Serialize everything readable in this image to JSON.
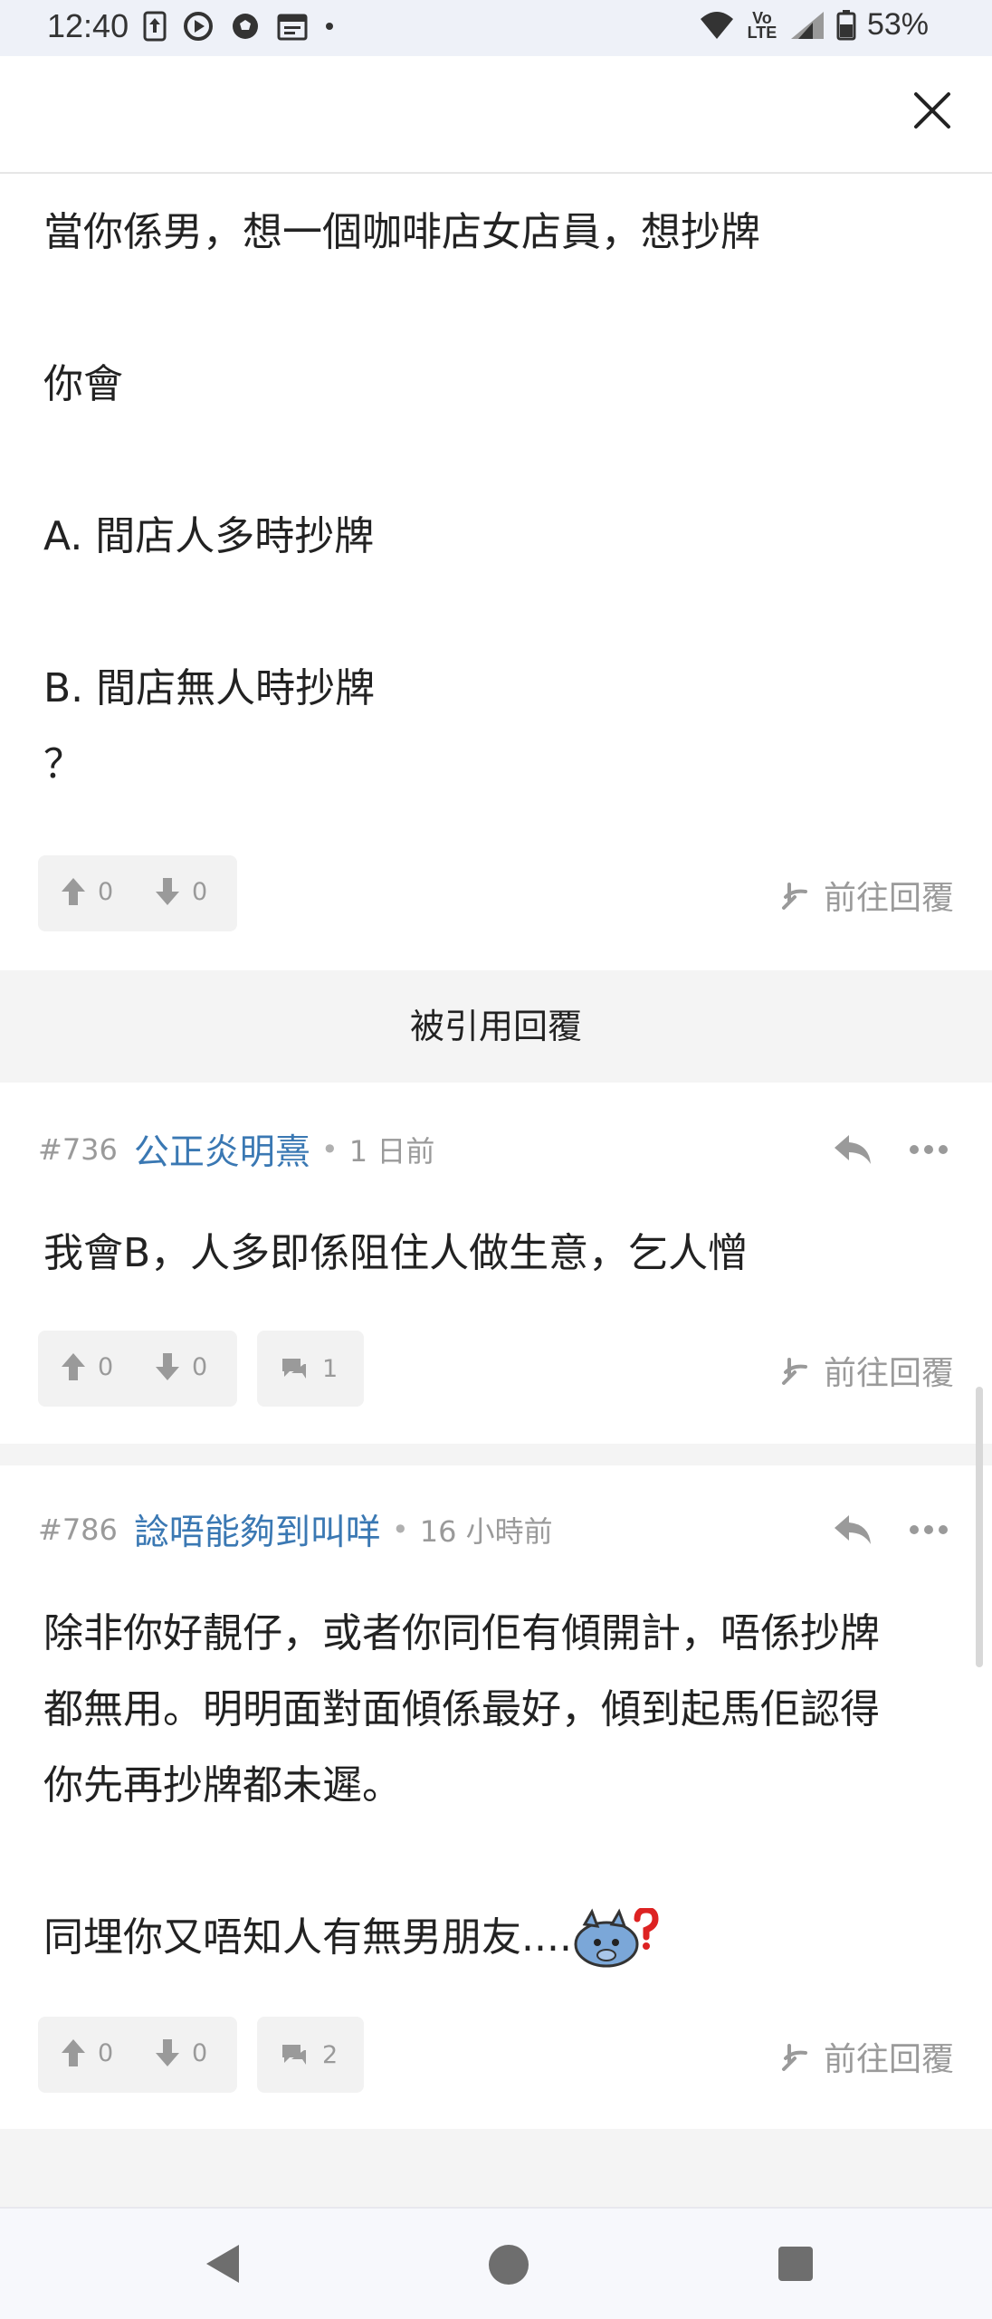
{
  "status_bar": {
    "time": "12:40",
    "network": "Vo LTE",
    "battery": "53%"
  },
  "post": {
    "paragraphs": [
      "當你係男，想一個咖啡店女店員，想抄牌",
      "你會",
      "A. 間店人多時抄牌",
      "B. 間店無人時抄牌",
      "？"
    ],
    "votes_up": "0",
    "votes_down": "0",
    "goto_label": "前往回覆"
  },
  "quoted_section": {
    "title": "被引用回覆"
  },
  "replies": [
    {
      "number": "#736",
      "user": "公正炎明熹",
      "time": "1 日前",
      "text": "我會B，人多即係阻住人做生意，乞人憎",
      "votes_up": "0",
      "votes_down": "0",
      "comments": "1",
      "goto_label": "前往回覆"
    },
    {
      "number": "#786",
      "user": "諗唔能夠到叫咩",
      "time": "16 小時前",
      "lines": [
        "除非你好靚仔，或者你同佢有傾開計，唔係抄牌",
        "都無用。明明面對面傾係最好，傾到起馬佢認得",
        "你先再抄牌都未遲。",
        "同埋你又唔知人有無男朋友...."
      ],
      "votes_up": "0",
      "votes_down": "0",
      "comments": "2",
      "goto_label": "前往回覆"
    }
  ],
  "colors": {
    "username": "#3a78b3",
    "muted": "#9a9a9a",
    "pill_bg": "#f2f2f2"
  }
}
